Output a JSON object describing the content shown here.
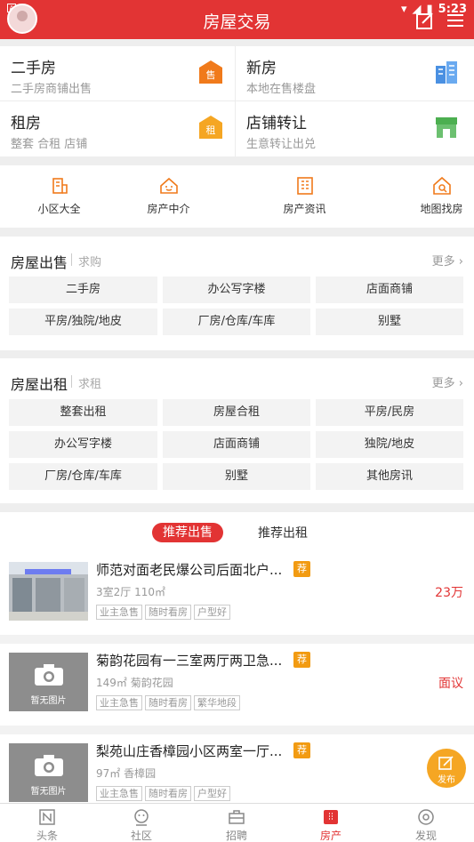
{
  "status_bar": {
    "time": "5:23"
  },
  "header": {
    "title": "房屋交易"
  },
  "categories": [
    {
      "title": "二手房",
      "subtitle": "二手房商铺出售",
      "icon": "sale-tag-icon",
      "icon_text": "售",
      "color": "#f07a1b"
    },
    {
      "title": "新房",
      "subtitle": "本地在售楼盘",
      "icon": "buildings-icon",
      "color": "#4a90e2"
    },
    {
      "title": "租房",
      "subtitle": "整套 合租 店铺",
      "icon": "rent-tag-icon",
      "icon_text": "租",
      "color": "#f5a623"
    },
    {
      "title": "店铺转让",
      "subtitle": "生意转让出兑",
      "icon": "storefront-icon",
      "color": "#4caf50"
    }
  ],
  "quick_links": [
    {
      "label": "小区大全",
      "icon": "community-icon"
    },
    {
      "label": "房产中介",
      "icon": "agent-house-icon"
    },
    {
      "label": "房产资讯",
      "icon": "news-building-icon"
    },
    {
      "label": "地图找房",
      "icon": "map-search-icon"
    }
  ],
  "sale_section": {
    "title": "房屋出售",
    "subtitle": "求购",
    "more": "更多",
    "items": [
      "二手房",
      "办公写字楼",
      "店面商铺",
      "平房/独院/地皮",
      "厂房/仓库/车库",
      "别墅"
    ]
  },
  "rent_section": {
    "title": "房屋出租",
    "subtitle": "求租",
    "more": "更多",
    "items": [
      "整套出租",
      "房屋合租",
      "平房/民房",
      "办公写字楼",
      "店面商铺",
      "独院/地皮",
      "厂房/仓库/车库",
      "别墅",
      "其他房讯"
    ]
  },
  "recommend_tabs": {
    "active": "推荐出售",
    "other": "推荐出租"
  },
  "listings": [
    {
      "title": "师范对面老民爆公司后面北户...",
      "badge": "荐",
      "meta": "3室2厅  110㎡",
      "tags": [
        "业主急售",
        "随时看房",
        "户型好"
      ],
      "price": "23万",
      "has_photo": true
    },
    {
      "title": "菊韵花园有一三室两厅两卫急...",
      "badge": "荐",
      "meta": "149㎡  菊韵花园",
      "tags": [
        "业主急售",
        "随时看房",
        "繁华地段"
      ],
      "price": "面议",
      "has_photo": false,
      "placeholder": "暂无图片"
    },
    {
      "title": "梨苑山庄香樟园小区两室一厅...",
      "badge": "荐",
      "meta": "97㎡  香樟园",
      "tags": [
        "业主急售",
        "随时看房",
        "户型好"
      ],
      "price": "",
      "has_photo": false,
      "placeholder": "暂无图片"
    }
  ],
  "fab": {
    "label": "发布"
  },
  "bottom_nav": [
    {
      "label": "头条",
      "icon": "headline-icon"
    },
    {
      "label": "社区",
      "icon": "community-face-icon"
    },
    {
      "label": "招聘",
      "icon": "briefcase-icon"
    },
    {
      "label": "房产",
      "icon": "building-icon",
      "active": true
    },
    {
      "label": "发现",
      "icon": "discover-icon"
    }
  ],
  "accent_color": "#e23434"
}
